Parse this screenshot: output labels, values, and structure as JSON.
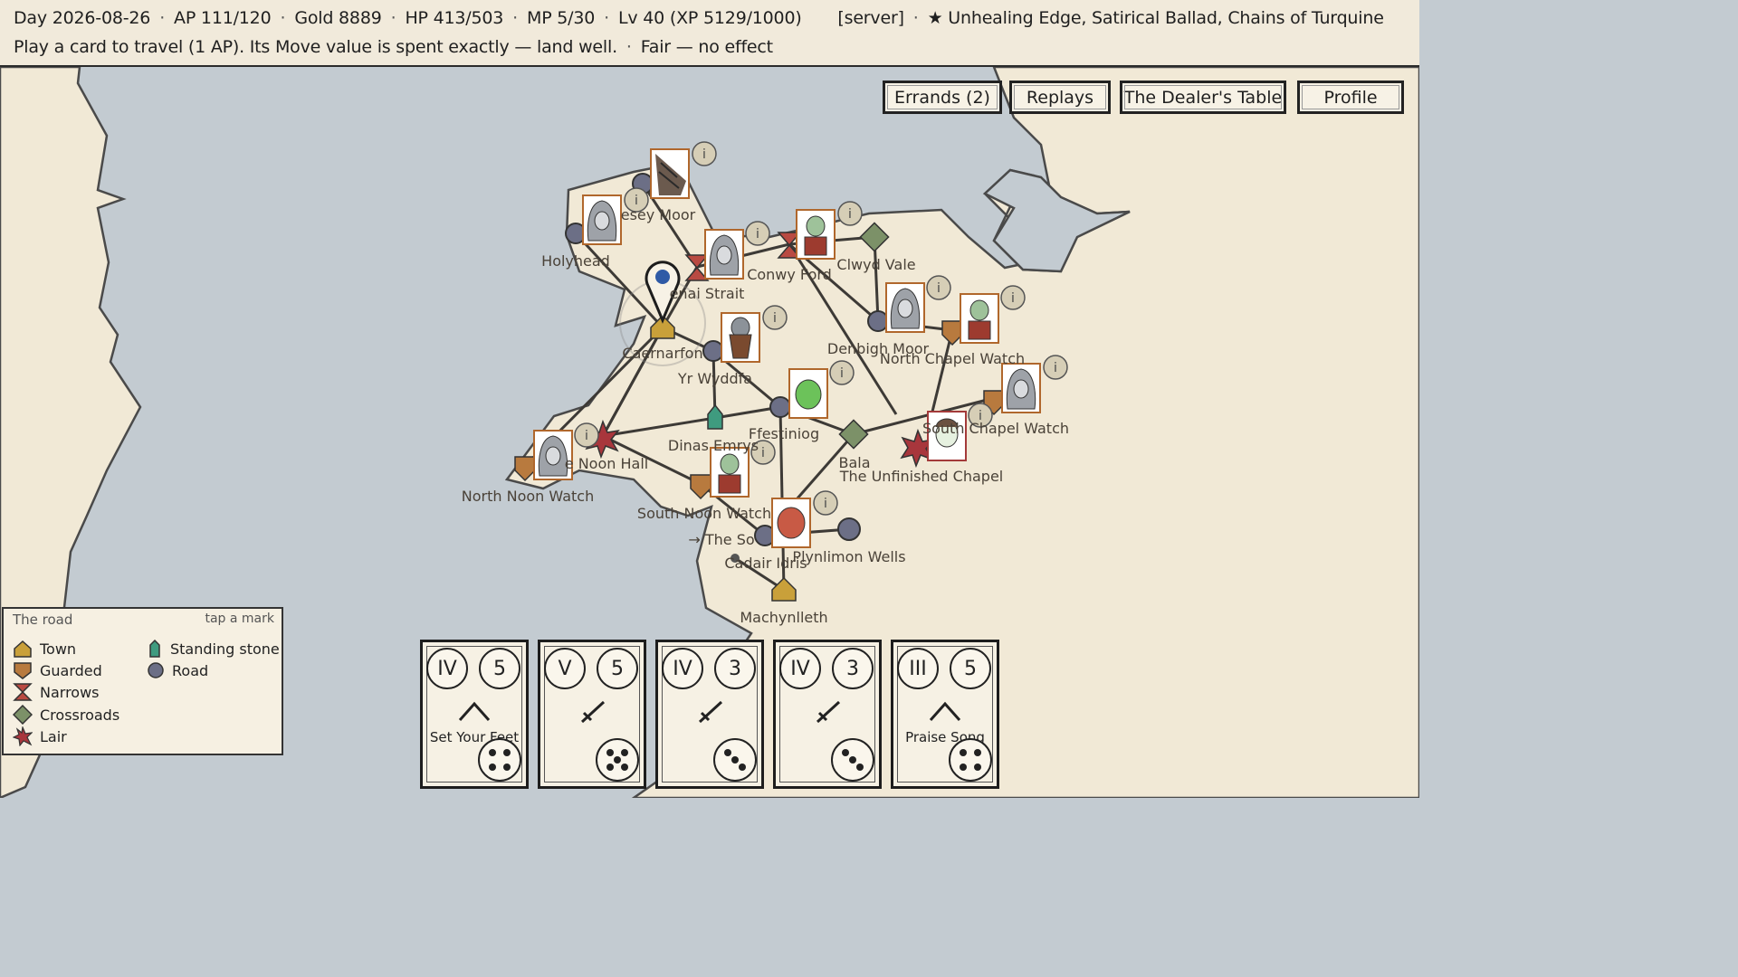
{
  "status": {
    "day": "Day 2026-08-26",
    "ap": "AP 111/120",
    "gold": "Gold 8889",
    "hp": "HP 413/503",
    "mp": "MP 5/30",
    "level": "Lv 40 (XP 5129/1000)",
    "server": "[server]",
    "effects": "★ Unhealing Edge, Satirical Ballad, Chains of Turquine",
    "hint": "Play a card to travel (1 AP). Its Move value is spent exactly — land well.",
    "weather": "Fair — no effect",
    "separator": "·"
  },
  "nav": {
    "errands": "Errands (2)",
    "replays": "Replays",
    "dealer": "The Dealer's Table",
    "profile": "Profile"
  },
  "map": {
    "colors": {
      "sea": "#c3cbd1",
      "land": "#f1e9d6",
      "coast": "#4a4a4a",
      "road": "#3d3a36"
    },
    "labels": {
      "anglesey": "esey Moor",
      "holyhead": "Holyhead",
      "menai": "enai Strait",
      "conwy": "Conwy Ford",
      "clwyd": "Clwyd Vale",
      "caernarfon": "Caernarfon",
      "denbigh": "Denbigh Moor",
      "northchapel": "North Chapel Watch",
      "yrwyddfa": "Yr Wyddfa",
      "ffestiniog": "Ffestiniog",
      "southchapel": "South Chapel Watch",
      "dinas": "Dinas Emrys",
      "bala": "Bala",
      "unfinished": "The Unfinished Chapel",
      "noonhall": "e Noon Hall",
      "northnoon": "North Noon Watch",
      "southnoon": "South Noon Watch",
      "theso": "→ The So",
      "cadair": "Cadair Idris",
      "plynlimon": "Plynlimon Wells",
      "machynlleth": "Machynlleth"
    },
    "info_glyph": "i"
  },
  "legend": {
    "title": "The road",
    "hint": "tap a mark",
    "items": {
      "town": "Town",
      "guarded": "Guarded",
      "narrows": "Narrows",
      "crossroads": "Crossroads",
      "lair": "Lair",
      "standing_stone": "Standing stone",
      "road": "Road"
    },
    "colors": {
      "town": "#c9a03a",
      "guarded": "#b87a3e",
      "narrows": "#b94a42",
      "crossroads": "#7c9168",
      "lair": "#a8363c",
      "standing_stone": "#3f9b7f",
      "road": "#6c6f86"
    }
  },
  "hand": [
    {
      "rank": "IV",
      "move": "5",
      "name": "Set Your Feet",
      "glyph": "caret-icon",
      "dice": 4
    },
    {
      "rank": "V",
      "move": "5",
      "name": "",
      "glyph": "dagger-icon",
      "dice": 5
    },
    {
      "rank": "IV",
      "move": "3",
      "name": "",
      "glyph": "dagger-icon",
      "dice": 3
    },
    {
      "rank": "IV",
      "move": "3",
      "name": "",
      "glyph": "dagger-icon",
      "dice": 3
    },
    {
      "rank": "III",
      "move": "5",
      "name": "Praise Song",
      "glyph": "caret-icon",
      "dice": 4
    }
  ]
}
